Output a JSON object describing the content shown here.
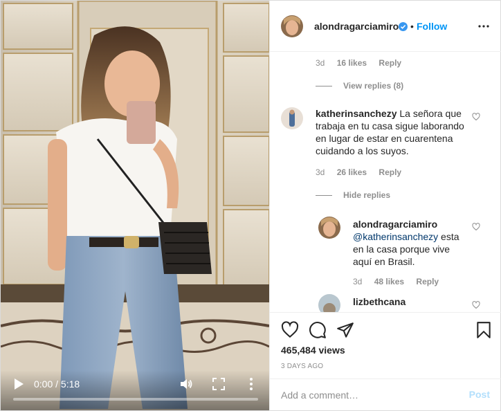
{
  "media": {
    "time": "0:00 / 5:18",
    "progress": 0.0,
    "controls": {
      "play": "play-icon",
      "volume": "volume-icon",
      "fullscreen": "fullscreen-icon",
      "more": "more-vertical-icon"
    }
  },
  "header": {
    "username": "alondragarciamiro",
    "verified": true,
    "separator": "•",
    "follow_label": "Follow",
    "more": "more-horizontal-icon"
  },
  "comments": {
    "top_meta": {
      "age": "3d",
      "likes": "16 likes",
      "reply": "Reply"
    },
    "view_replies": "View replies (8)",
    "items": [
      {
        "username": "katherinsanchezy",
        "text": "La señora que trabaja en tu casa sigue laborando en lugar de estar en cuarentena cuidando a los suyos.",
        "age": "3d",
        "likes": "26 likes",
        "reply": "Reply",
        "replies_toggle": "Hide replies",
        "replies": [
          {
            "username": "alondragarciamiro",
            "mention": "@katherinsanchezy",
            "text": " esta en la casa porque vive aquí en Brasil.",
            "age": "3d",
            "likes": "48 likes",
            "reply": "Reply"
          },
          {
            "username": "lizbethcana",
            "text": ""
          }
        ]
      }
    ]
  },
  "actions": {
    "like": "heart-icon",
    "comment": "comment-icon",
    "share": "share-icon",
    "save": "bookmark-icon",
    "views": "465,484 views",
    "time_ago": "3 DAYS AGO"
  },
  "add_comment": {
    "placeholder": "Add a comment…",
    "post_label": "Post"
  },
  "colors": {
    "accent": "#0095f6",
    "post_disabled": "#b2dffc",
    "secondary_text": "#8e8e8e",
    "verified": "#3897f0"
  }
}
